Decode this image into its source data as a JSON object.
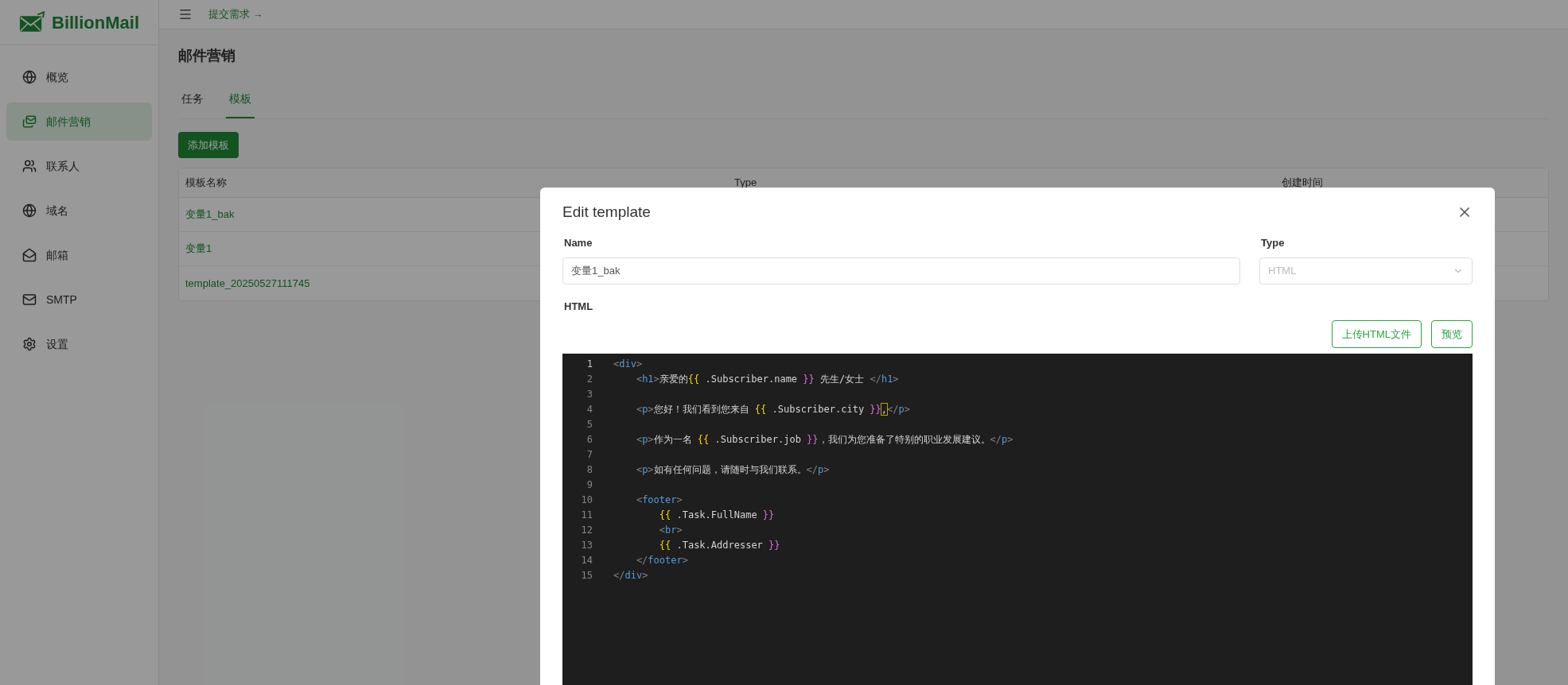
{
  "sidebar": {
    "brand": "BillionMail",
    "items": [
      {
        "label": "概览",
        "selected": false
      },
      {
        "label": "邮件营销",
        "selected": true
      },
      {
        "label": "联系人",
        "selected": false
      },
      {
        "label": "域名",
        "selected": false
      },
      {
        "label": "邮箱",
        "selected": false
      },
      {
        "label": "SMTP",
        "selected": false
      },
      {
        "label": "设置",
        "selected": false
      }
    ]
  },
  "topbar": {
    "link": "提交需求 →"
  },
  "page": {
    "title": "邮件营销",
    "tabs": [
      {
        "label": "任务",
        "selected": false
      },
      {
        "label": "模板",
        "selected": true
      }
    ],
    "add_button": "添加模板",
    "table": {
      "columns": [
        "模板名称",
        "Type",
        "创建时间"
      ],
      "rows": [
        [
          "变量1_bak"
        ],
        [
          "变量1"
        ],
        [
          "template_20250527111745"
        ]
      ]
    }
  },
  "dialog": {
    "title": "Edit template",
    "name_label": "Name",
    "name_value": "变量1_bak",
    "type_label": "Type",
    "type_value": "HTML",
    "html_label": "HTML",
    "buttons": [
      "上传HTML文件",
      "预览"
    ],
    "code": [
      {
        "number": "1",
        "current": true,
        "tokens": [
          {
            "kind": "punct",
            "text": "<"
          },
          {
            "kind": "tag",
            "text": "div"
          },
          {
            "kind": "punct",
            "text": ">"
          }
        ]
      },
      {
        "number": "2",
        "current": false,
        "tokens": [
          {
            "kind": "punct",
            "text": "    <"
          },
          {
            "kind": "tag",
            "text": "h1"
          },
          {
            "kind": "punct",
            "text": ">"
          },
          {
            "kind": "text",
            "text": "亲爱的"
          },
          {
            "kind": "open",
            "text": "{{"
          },
          {
            "kind": "text",
            "text": " .Subscriber.name "
          },
          {
            "kind": "close",
            "text": "}}"
          },
          {
            "kind": "text",
            "text": " 先生/女士 "
          },
          {
            "kind": "punct",
            "text": "</"
          },
          {
            "kind": "tag",
            "text": "h1"
          },
          {
            "kind": "punct",
            "text": ">"
          }
        ]
      },
      {
        "number": "3",
        "current": false
      },
      {
        "number": "4",
        "current": false,
        "tokens": [
          {
            "kind": "punct",
            "text": "    <"
          },
          {
            "kind": "tag",
            "text": "p"
          },
          {
            "kind": "punct",
            "text": ">"
          },
          {
            "kind": "text",
            "text": "您好！我们看到您来自 "
          },
          {
            "kind": "open",
            "text": "{{"
          },
          {
            "kind": "text",
            "text": " .Subscriber.city "
          },
          {
            "kind": "close",
            "text": "}}"
          },
          {
            "kind": "match",
            "text": ","
          },
          {
            "kind": "punct",
            "text": "</"
          },
          {
            "kind": "tag",
            "text": "p"
          },
          {
            "kind": "punct",
            "text": ">"
          }
        ]
      },
      {
        "number": "5",
        "current": false
      },
      {
        "number": "6",
        "current": false,
        "tokens": [
          {
            "kind": "punct",
            "text": "    <"
          },
          {
            "kind": "tag",
            "text": "p"
          },
          {
            "kind": "punct",
            "text": ">"
          },
          {
            "kind": "text",
            "text": "作为一名 "
          },
          {
            "kind": "open",
            "text": "{{"
          },
          {
            "kind": "text",
            "text": " .Subscriber.job "
          },
          {
            "kind": "close",
            "text": "}}"
          },
          {
            "kind": "text",
            "text": "，我们为您准备了特别的职业发展建议。"
          },
          {
            "kind": "punct",
            "text": "</"
          },
          {
            "kind": "tag",
            "text": "p"
          },
          {
            "kind": "punct",
            "text": ">"
          }
        ]
      },
      {
        "number": "7",
        "current": false
      },
      {
        "number": "8",
        "current": false,
        "tokens": [
          {
            "kind": "punct",
            "text": "    <"
          },
          {
            "kind": "tag",
            "text": "p"
          },
          {
            "kind": "punct",
            "text": ">"
          },
          {
            "kind": "text",
            "text": "如有任何问题，请随时与我们联系。"
          },
          {
            "kind": "punct",
            "text": "</"
          },
          {
            "kind": "tag",
            "text": "p"
          },
          {
            "kind": "punct",
            "text": ">"
          }
        ]
      },
      {
        "number": "9",
        "current": false
      },
      {
        "number": "10",
        "current": false,
        "tokens": [
          {
            "kind": "punct",
            "text": "    <"
          },
          {
            "kind": "tag",
            "text": "footer"
          },
          {
            "kind": "punct",
            "text": ">"
          }
        ]
      },
      {
        "number": "11",
        "current": false,
        "tokens": [
          {
            "kind": "open",
            "text": "        {{"
          },
          {
            "kind": "text",
            "text": " .Task.FullName "
          },
          {
            "kind": "close",
            "text": "}}"
          }
        ]
      },
      {
        "number": "12",
        "current": false,
        "tokens": [
          {
            "kind": "punct",
            "text": "        <"
          },
          {
            "kind": "tag",
            "text": "br"
          },
          {
            "kind": "punct",
            "text": ">"
          }
        ]
      },
      {
        "number": "13",
        "current": false,
        "tokens": [
          {
            "kind": "open",
            "text": "        {{"
          },
          {
            "kind": "text",
            "text": " .Task.Addresser "
          },
          {
            "kind": "close",
            "text": "}}"
          }
        ]
      },
      {
        "number": "14",
        "current": false,
        "tokens": [
          {
            "kind": "punct",
            "text": "    </"
          },
          {
            "kind": "tag",
            "text": "footer"
          },
          {
            "kind": "punct",
            "text": ">"
          }
        ]
      },
      {
        "number": "15",
        "current": false,
        "tokens": [
          {
            "kind": "punct",
            "text": "</"
          },
          {
            "kind": "tag",
            "text": "div"
          },
          {
            "kind": "punct",
            "text": ">"
          }
        ]
      }
    ]
  }
}
